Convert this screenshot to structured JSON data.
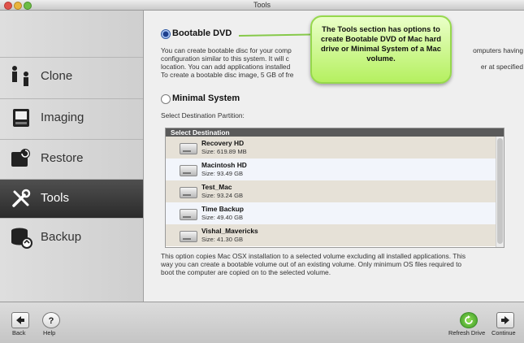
{
  "window": {
    "title": "Tools"
  },
  "sidebar": {
    "items": [
      {
        "label": "Clone",
        "icon": "clone-icon"
      },
      {
        "label": "Imaging",
        "icon": "imaging-icon"
      },
      {
        "label": "Restore",
        "icon": "restore-icon"
      },
      {
        "label": "Tools",
        "icon": "tools-icon",
        "active": true
      },
      {
        "label": "Backup",
        "icon": "backup-icon"
      }
    ]
  },
  "main": {
    "option_bootable": {
      "label": "Bootable DVD",
      "selected": true,
      "description_lines": [
        "You can create bootable disc for your comp",
        "configuration similar to this system.  It will c",
        "location. You can add applications installed",
        "To create a bootable disc image, 5 GB of fre"
      ],
      "description_right_lines": [
        "omputers having",
        "er at specified"
      ]
    },
    "option_minimal": {
      "label": "Minimal System",
      "selected": false
    },
    "destination_prompt": "Select Destination Partition:",
    "destination_list": {
      "header": "Select Destination",
      "drives": [
        {
          "name": "Recovery HD",
          "size": "Size: 619.89 MB"
        },
        {
          "name": "Macintosh HD",
          "size": "Size: 93.49 GB"
        },
        {
          "name": "Test_Mac",
          "size": "Size: 93.24 GB"
        },
        {
          "name": "Time Backup",
          "size": "Size: 49.40 GB"
        },
        {
          "name": "Vishal_Mavericks",
          "size": "Size: 41.30 GB"
        }
      ]
    },
    "footer_lines": [
      "This option copies Mac OSX installation to a selected volume excluding all installed applications. This",
      "way you can create a bootable volume out  of an existing volume. Only minimum OS files required to",
      "boot the computer are copied on to the selected volume."
    ]
  },
  "callout": {
    "text": "The Tools section has options to create Bootable DVD of Mac hard drive or Minimal System of a Mac volume."
  },
  "toolbar": {
    "back_label": "Back",
    "help_label": "Help",
    "refresh_label": "Refresh Drive",
    "continue_label": "Continue"
  },
  "colors": {
    "active_nav": "#2f2f2f",
    "callout_fill": "#c6f27d",
    "callout_border": "#96d84d",
    "list_header": "#5a5a5a"
  }
}
